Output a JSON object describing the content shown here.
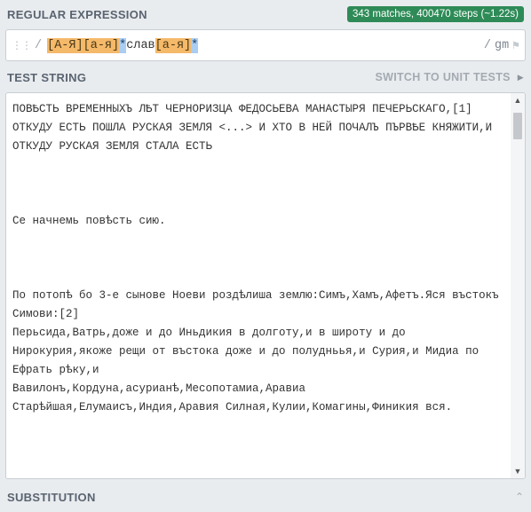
{
  "regex_section": {
    "title": "REGULAR EXPRESSION",
    "match_badge": "343 matches, 400470 steps (~1.22s)",
    "delimiter_open": "/",
    "tokens": [
      {
        "text": "[А-Я]",
        "kind": "set"
      },
      {
        "text": "[а-я]",
        "kind": "set"
      },
      {
        "text": "*",
        "kind": "quant"
      },
      {
        "text": "слав",
        "kind": "lit"
      },
      {
        "text": "[а-я]",
        "kind": "set"
      },
      {
        "text": "*",
        "kind": "quant"
      }
    ],
    "delimiter_close": "/",
    "flags": "gm",
    "flag_icon": "flag-icon"
  },
  "test_section": {
    "title": "TEST STRING",
    "switch_label": "SWITCH TO UNIT TESTS",
    "switch_icon": "chevron-right-icon",
    "text": "ПОВѢСТЬ ВРЕМЕННЫХЪ ЛѢТ ЧЕРНОРИЗЦА ФЕДОСЬЕВА МАНАСТЫРЯ ПЕЧЕРЬСКАГО,[1] ОТКУДУ ЕСТЬ ПОШЛА РУСКАЯ ЗЕМЛЯ <...> И ХТО В НЕЙ ПОЧАЛЪ ПЪРВѢЕ КНЯЖИТИ,И ОТКУДУ РУСКАЯ ЗЕМЛЯ СТАЛА ЕСТЬ\n\n\n\nСе начнемь повѣсть сию.\n\n\n\nПо потопѣ бо 3-е сынове Ноеви роздѣлиша землю:Симъ,Хамъ,Афетъ.Яся въстокъ Симови:[2]\nПерьсида,Ватрь,доже и до Иньдикия в долготу,и в широту и до Нирокурия,якоже рещи от въстока доже и до полудньья,и Сурия,и Мидиа по Ефрать рѣку,и\nВавилонъ,Кордуна,асурианѣ,Месопотамиа,Аравиа\nСтарѣйшая,Елумаисъ,Индия,Аравия Силная,Кулии,Комагины,Финикия вся."
  },
  "substitution_section": {
    "title": "SUBSTITUTION",
    "collapse_icon": "chevron-up-icon"
  },
  "colors": {
    "badge": "#2e8b57",
    "char_set": "#f5b96a",
    "quantifier": "#a9cdf3"
  }
}
